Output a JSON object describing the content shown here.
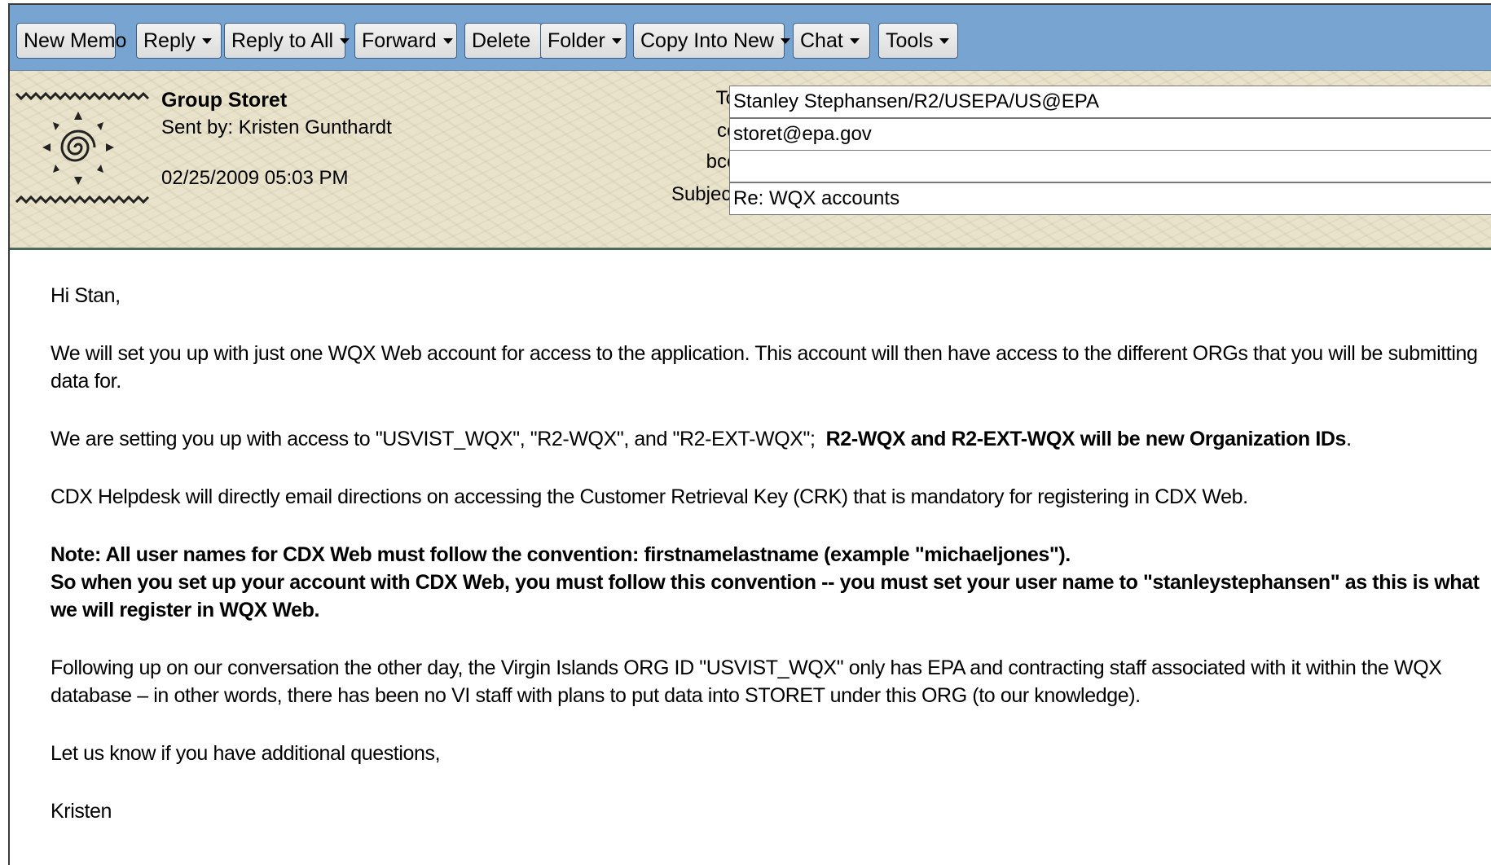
{
  "toolbar": {
    "buttons": [
      {
        "label": "New Memo",
        "dropdown": false
      },
      {
        "label": "Reply",
        "dropdown": true
      },
      {
        "label": "Reply to All",
        "dropdown": true
      },
      {
        "label": "Forward",
        "dropdown": true
      },
      {
        "label": "Delete",
        "dropdown": false
      },
      {
        "label": "Folder",
        "dropdown": true
      },
      {
        "label": "Copy Into New",
        "dropdown": true
      },
      {
        "label": "Chat",
        "dropdown": true
      },
      {
        "label": "Tools",
        "dropdown": true
      }
    ]
  },
  "header": {
    "sender_name": "Group Storet",
    "sent_by": "Sent by: Kristen Gunthardt",
    "date": "02/25/2009 05:03 PM",
    "to_label": "To",
    "to_value": "Stanley Stephansen/R2/USEPA/US@EPA",
    "cc_label": "cc",
    "cc_value": "storet@epa.gov",
    "bcc_label": "bcc",
    "bcc_value": "",
    "subject_label": "Subject",
    "subject_value": "Re: WQX accounts"
  },
  "body": {
    "greeting": "Hi Stan,",
    "p1": "We will set you up with just one WQX Web account for access to the application.  This account will then have access to the different ORGs that you will be submitting data for.",
    "p2_plain": "We are setting you up with access to \"USVIST_WQX\", \"R2-WQX\", and \"R2-EXT-WQX\";  ",
    "p2_bold": "R2-WQX and R2-EXT-WQX will be new Organization IDs",
    "p2_end": ".",
    "p3": "CDX Helpdesk will directly email directions on accessing the Customer Retrieval Key (CRK) that is mandatory for registering in CDX Web.",
    "note1": "Note: All user names for CDX Web must follow the convention: firstnamelastname (example \"michaeljones\").",
    "note2": "So when you set up your account with CDX Web, you must follow this convention -- you must set your user name to \"stanleystephansen\" as this is what we will register in WQX Web.",
    "p4": "Following up on our conversation the other day, the Virgin Islands ORG ID \"USVIST_WQX\" only has EPA and contracting staff associated with it within the WQX database – in other words, there has been no VI staff with plans to put data into STORET under this ORG (to our knowledge).",
    "p5": "Let us know if you have additional questions,",
    "signature": "Kristen"
  },
  "colors": {
    "toolbar_bg": "#77a4d0",
    "header_bg": "#e9e3cb",
    "header_divider": "#4a6a58"
  },
  "icons": {
    "logo": "spiral-sun-logo-icon",
    "dropdown": "caret-down-icon"
  }
}
